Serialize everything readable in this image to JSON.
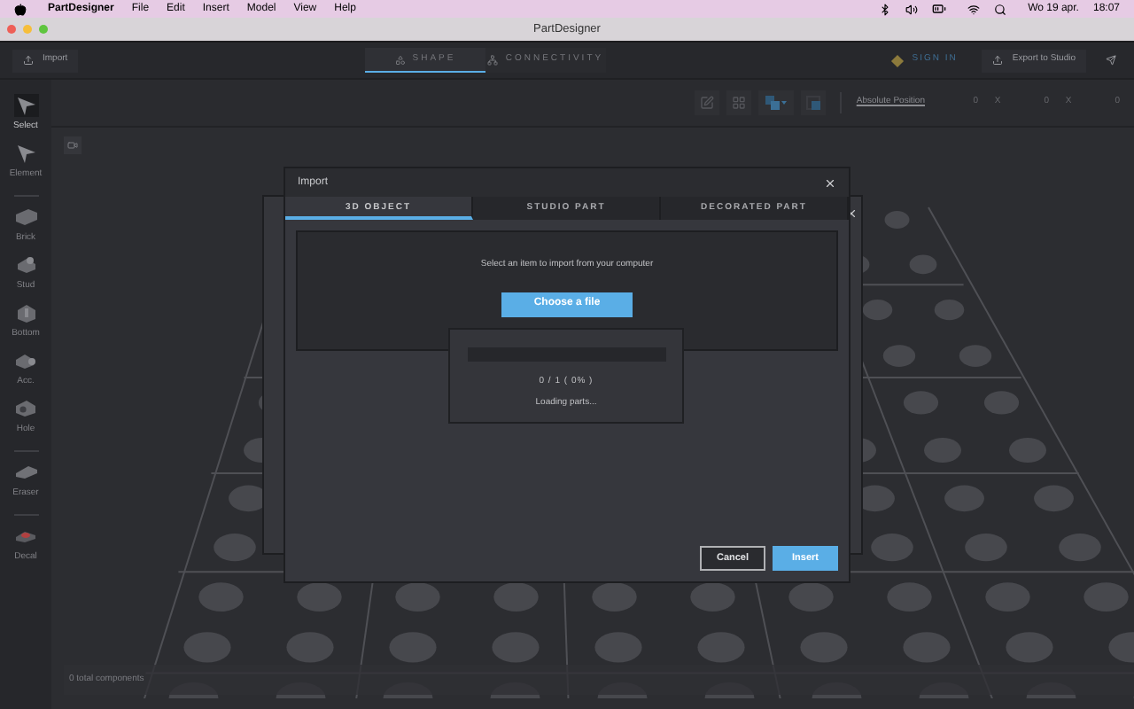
{
  "menu_bar": {
    "app_name": "PartDesigner",
    "menus": [
      "File",
      "Edit",
      "Insert",
      "Model",
      "View",
      "Help"
    ],
    "date": "Wo 19 apr.",
    "time": "18:07"
  },
  "window": {
    "title": "PartDesigner"
  },
  "toolbar": {
    "import_label": "Import",
    "tabs": [
      {
        "label": "SHAPE",
        "selected": true
      },
      {
        "label": "CONNECTIVITY",
        "selected": false
      }
    ],
    "sign_in": "SIGN IN",
    "export_label": "Export to Studio"
  },
  "position_bar": {
    "label": "Absolute Position",
    "fields": [
      {
        "value": "0",
        "axis": "X"
      },
      {
        "value": "0",
        "axis": "X"
      },
      {
        "value": "0"
      }
    ]
  },
  "tool_groups": [
    [
      {
        "label": "Select",
        "kind": "pointer",
        "selected": true
      },
      {
        "label": "Element",
        "kind": "pointer",
        "selected": false
      }
    ],
    [
      {
        "label": "Brick",
        "kind": "brick",
        "selected": false
      },
      {
        "label": "Stud",
        "kind": "stud",
        "selected": false
      },
      {
        "label": "Bottom",
        "kind": "bottom",
        "selected": false
      },
      {
        "label": "Acc.",
        "kind": "accessory",
        "selected": false
      },
      {
        "label": "Hole",
        "kind": "hole",
        "selected": false
      }
    ],
    [
      {
        "label": "Eraser",
        "kind": "eraser",
        "selected": false
      }
    ],
    [
      {
        "label": "Decal",
        "kind": "decal",
        "selected": false
      }
    ]
  ],
  "status_bar": {
    "text": "0 total components"
  },
  "dialog": {
    "title": "Import",
    "tabs": [
      {
        "label": "3D OBJECT",
        "selected": true
      },
      {
        "label": "STUDIO PART",
        "selected": false
      },
      {
        "label": "DECORATED PART",
        "selected": false
      }
    ],
    "prompt": "Select an item to import from your computer",
    "choose_button": "Choose a file",
    "progress": {
      "level": 0,
      "count": "0 / 1 ( 0% )",
      "message": "Loading parts..."
    },
    "buttons": [
      {
        "label": "Cancel",
        "kind": "secondary"
      },
      {
        "label": "Insert",
        "kind": "primary"
      }
    ]
  }
}
